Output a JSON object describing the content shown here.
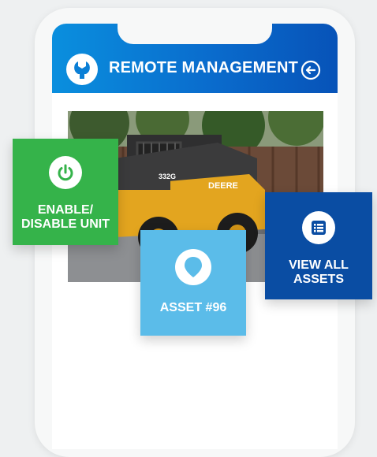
{
  "header": {
    "title": "REMOTE MANAGEMENT",
    "app_icon": "wrench-icon",
    "back_icon": "arrow-left-circle-icon",
    "gradient": [
      "#0a8fde",
      "#0753b8"
    ]
  },
  "photo": {
    "subject": "skid steer loader",
    "model_text": "332G",
    "brand_text": "DEERE"
  },
  "cards": {
    "enable": {
      "label": "ENABLE/\nDISABLE UNIT",
      "icon": "power-icon",
      "color": "#35b34a"
    },
    "asset": {
      "label": "ASSET #96",
      "icon": "location-pin-icon",
      "color": "#5bbce9"
    },
    "view_all": {
      "label": "VIEW ALL\nASSETS",
      "icon": "list-icon",
      "color": "#0a4da3"
    }
  }
}
